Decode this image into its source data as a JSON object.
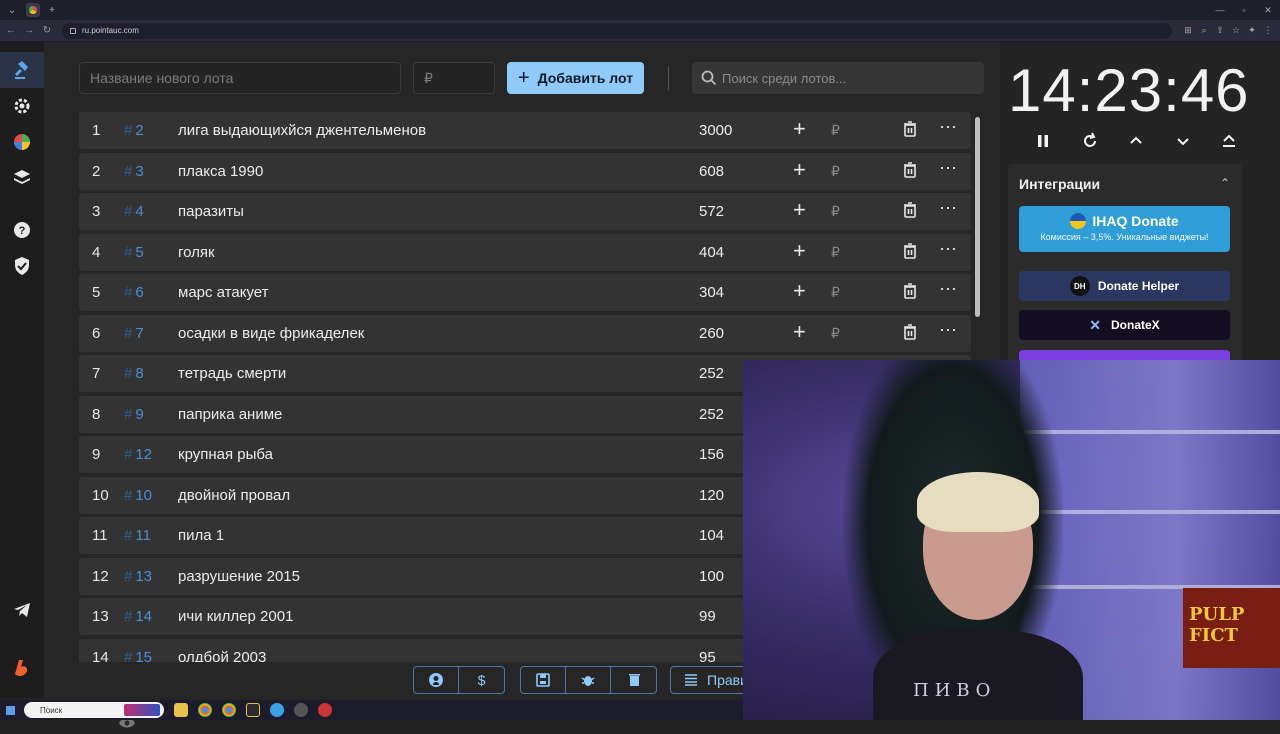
{
  "browser": {
    "url": "ru.pointauc.com"
  },
  "form": {
    "lot_name_placeholder": "Название нового лота",
    "amount_placeholder": "₽",
    "add_button_label": "Добавить лот",
    "search_placeholder": "Поиск среди лотов..."
  },
  "lots": [
    {
      "pos": "1",
      "id": "2",
      "name": "лига выдающихйся джентельменов",
      "amount": "3000"
    },
    {
      "pos": "2",
      "id": "3",
      "name": "плакса 1990",
      "amount": "608"
    },
    {
      "pos": "3",
      "id": "4",
      "name": "паразиты",
      "amount": "572"
    },
    {
      "pos": "4",
      "id": "5",
      "name": "голяк",
      "amount": "404"
    },
    {
      "pos": "5",
      "id": "6",
      "name": "марс атакует",
      "amount": "304"
    },
    {
      "pos": "6",
      "id": "7",
      "name": "осадки в виде фрикаделек",
      "amount": "260"
    },
    {
      "pos": "7",
      "id": "8",
      "name": "тетрадь смерти",
      "amount": "252"
    },
    {
      "pos": "8",
      "id": "9",
      "name": "паприка аниме",
      "amount": "252"
    },
    {
      "pos": "9",
      "id": "12",
      "name": "крупная рыба",
      "amount": "156"
    },
    {
      "pos": "10",
      "id": "10",
      "name": " двойной провал",
      "amount": "120"
    },
    {
      "pos": "11",
      "id": "11",
      "name": "пила 1",
      "amount": "104"
    },
    {
      "pos": "12",
      "id": "13",
      "name": "разрушение 2015",
      "amount": "100"
    },
    {
      "pos": "13",
      "id": "14",
      "name": "ичи киллер 2001",
      "amount": "99"
    },
    {
      "pos": "14",
      "id": "15",
      "name": "олдбой 2003",
      "amount": "95"
    }
  ],
  "lot_row": {
    "hash": "#",
    "add": "+",
    "currency": "₽",
    "more": "⋯"
  },
  "timer": {
    "time": "14:23:46"
  },
  "integrations": {
    "title": "Интеграции",
    "ihaq": {
      "label": "IHAQ Donate",
      "sub": "Комиссия – 3,5%. Уникальные виджеты!"
    },
    "donate_helper": {
      "label": "Donate Helper",
      "logo": "DH"
    },
    "donatex": {
      "label": "DonateX"
    }
  },
  "bottom": {
    "rules_label": "Прави"
  },
  "webcam": {
    "shirt_text": "ПИВО",
    "poster_text": "PULP FICT"
  },
  "taskbar": {
    "search_label": "Поиск"
  },
  "colors": {
    "accent": "#90caf9",
    "lot_id": "#4a8fd6",
    "ihaq": "#2f9ed8",
    "donate_helper": "#2a3760",
    "donatex": "#150e22"
  }
}
